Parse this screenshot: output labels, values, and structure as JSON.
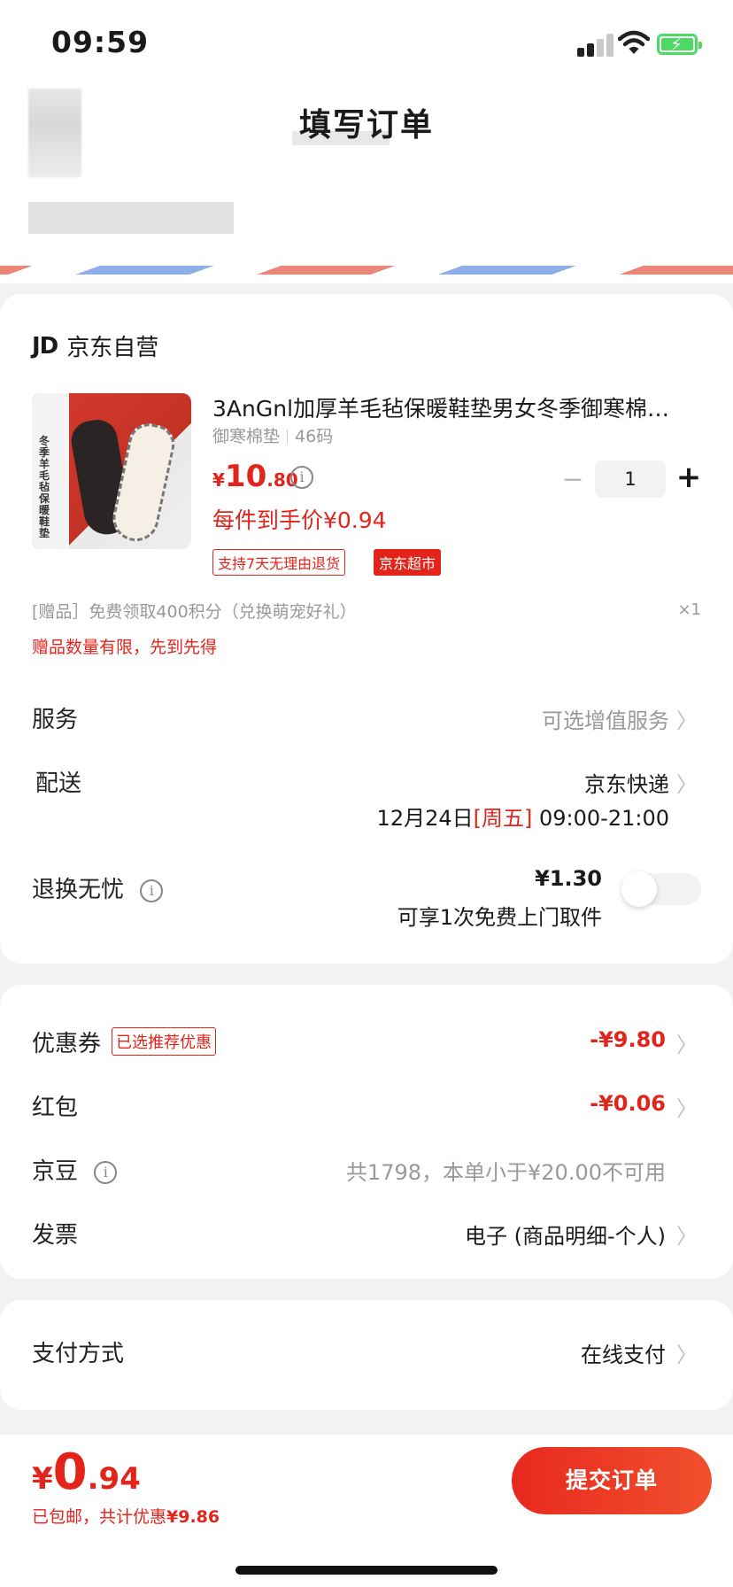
{
  "status": {
    "time": "09:59"
  },
  "header": {
    "title": "填写订单"
  },
  "shop": {
    "logo": "JD",
    "name": "京东自营"
  },
  "product": {
    "title": "3AnGnl加厚羊毛毡保暖鞋垫男女冬季御寒棉…",
    "spec_name": "御寒棉垫",
    "spec_size": "46码",
    "price_currency": "¥",
    "price_int": "10",
    "price_dec": ".80",
    "unit_price": "每件到手价¥0.94",
    "quantity": "1",
    "tag_return": "支持7天无理由退货",
    "tag_store": "京东超市",
    "image_text": "冬季羊毛毡保暖鞋垫"
  },
  "gift": {
    "text": "[赠品］免费领取400积分（兑换萌宠好礼）",
    "qty": "×1",
    "note": "赠品数量有限，先到先得"
  },
  "service": {
    "label": "服务",
    "value": "可选增值服务"
  },
  "delivery": {
    "label": "配送",
    "carrier": "京东快递",
    "date": "12月24日",
    "weekday": "[周五]",
    "time_range": "09:00-21:00"
  },
  "return_care": {
    "label": "退换无忧",
    "price": "¥1.30",
    "desc": "可享1次免费上门取件",
    "enabled": false
  },
  "coupon": {
    "label": "优惠券",
    "badge": "已选推荐优惠",
    "value": "-¥9.80"
  },
  "red_packet": {
    "label": "红包",
    "value": "-¥0.06"
  },
  "jd_beans": {
    "label": "京豆",
    "value": "共1798，本单小于¥20.00不可用"
  },
  "invoice": {
    "label": "发票",
    "value": "电子 (商品明细-个人)"
  },
  "payment": {
    "label": "支付方式",
    "value": "在线支付"
  },
  "footer": {
    "total_currency": "¥",
    "total_int": "0",
    "total_dec": ".94",
    "note_prefix": "已包邮，共计优惠",
    "note_amount": "¥9.86",
    "submit_label": "提交订单"
  },
  "colors": {
    "accent": "#e3241b",
    "background": "#f2f2f2"
  }
}
